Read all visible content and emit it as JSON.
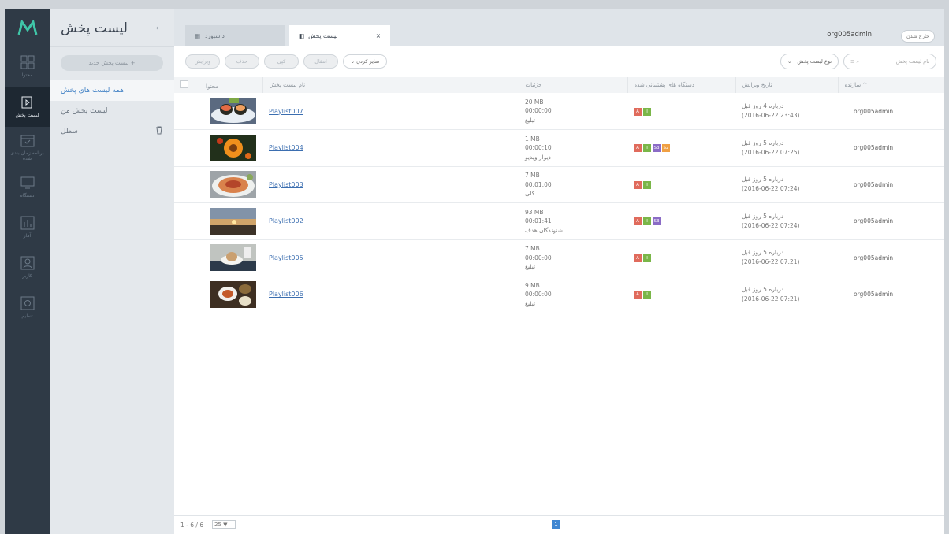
{
  "app": {
    "logo": "M"
  },
  "rail": [
    {
      "label": "محتوا",
      "icon": "grid-icon"
    },
    {
      "label": "لیست پخش",
      "icon": "playlist-icon",
      "active": true
    },
    {
      "label": "برنامه زمان بندی شده",
      "icon": "calendar-icon"
    },
    {
      "label": "دستگاه",
      "icon": "monitor-icon"
    },
    {
      "label": "آمار",
      "icon": "chart-icon"
    },
    {
      "label": "کاربر",
      "icon": "user-icon"
    },
    {
      "label": "تنظیم",
      "icon": "gear-icon"
    }
  ],
  "side": {
    "title": "لیست پخش",
    "new_button": "لیست پخش جدید +",
    "items": [
      "همه لیست های پخش",
      "لیست پخش من",
      "سطل"
    ]
  },
  "tabs": {
    "dashboard": "داشبورد",
    "playlist": "لیست پخش",
    "close": "×"
  },
  "header": {
    "user": "org005admin",
    "logout": "خارج شدن"
  },
  "toolbar": {
    "edit": "ویرایش",
    "delete": "حذف",
    "copy": "کپی",
    "move": "انتقال",
    "more": "سایر کردن",
    "type_select": "نوع لیست پخش",
    "search_placeholder": "نام لیست پخش"
  },
  "columns": {
    "content": "محتوا",
    "name": "نام لیست پخش",
    "details": "جزئیات",
    "devices": "دستگاه های پشتیبانی شده",
    "edited": "تاریخ ویرایش",
    "creator": "سازنده ^"
  },
  "rows": [
    {
      "name": "Playlist007",
      "size": "20 MB",
      "duration": "00:00:00",
      "type": "تبلیغ",
      "badges": [
        "A",
        "I"
      ],
      "ago": "درباره 4 روز قبل",
      "date": "(2016-06-22 23:43)",
      "creator": "org005admin",
      "thumb": "sushi"
    },
    {
      "name": "Playlist004",
      "size": "1 MB",
      "duration": "00:00:10",
      "type": "دیوار ویدیو",
      "badges": [
        "A",
        "I",
        "S3",
        "S2"
      ],
      "ago": "درباره 5 روز قبل",
      "date": "(2016-06-22 07:25)",
      "creator": "org005admin",
      "thumb": "flower"
    },
    {
      "name": "Playlist003",
      "size": "7 MB",
      "duration": "00:01:00",
      "type": "کلی",
      "badges": [
        "A",
        "I"
      ],
      "ago": "درباره 5 روز قبل",
      "date": "(2016-06-22 07:24)",
      "creator": "org005admin",
      "thumb": "pasta"
    },
    {
      "name": "Playlist002",
      "size": "93 MB",
      "duration": "00:01:41",
      "type": "شنوندگان هدف",
      "badges": [
        "A",
        "I",
        "S3"
      ],
      "ago": "درباره 5 روز قبل",
      "date": "(2016-06-22 07:24)",
      "creator": "org005admin",
      "thumb": "sunset"
    },
    {
      "name": "Playlist005",
      "size": "7 MB",
      "duration": "00:00:00",
      "type": "تبلیغ",
      "badges": [
        "A",
        "I"
      ],
      "ago": "درباره 5 روز قبل",
      "date": "(2016-06-22 07:21)",
      "creator": "org005admin",
      "thumb": "dessert"
    },
    {
      "name": "Playlist006",
      "size": "9 MB",
      "duration": "00:00:00",
      "type": "تبلیغ",
      "badges": [
        "A",
        "I"
      ],
      "ago": "درباره 5 روز قبل",
      "date": "(2016-06-22 07:21)",
      "creator": "org005admin",
      "thumb": "meal"
    }
  ],
  "badge_colors": {
    "A": "#e06b5c",
    "I": "#7ab648",
    "S3": "#8b6cc6",
    "S2": "#f0a043"
  },
  "pager": {
    "count": "1 - 6 / 6",
    "per_page": "25 ▼",
    "page": "1"
  }
}
